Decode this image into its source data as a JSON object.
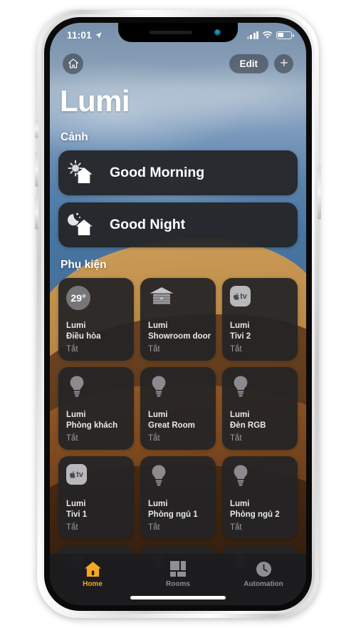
{
  "device": {
    "frame": "iphone-x-silver"
  },
  "status_bar": {
    "time": "11:01",
    "location_icon": "location-arrow-icon",
    "signal_icon": "cellular-signal-icon",
    "signal_bars": 4,
    "signal_filled": 3,
    "wifi_icon": "wifi-icon",
    "battery_icon": "battery-icon",
    "battery_level": 38
  },
  "nav": {
    "home_icon": "house-icon",
    "edit_label": "Edit",
    "add_label": "+",
    "add_icon": "plus-icon"
  },
  "header": {
    "title": "Lumi"
  },
  "scenes": {
    "section_title": "Cảnh",
    "items": [
      {
        "label": "Good Morning",
        "icon": "sun-house-icon"
      },
      {
        "label": "Good Night",
        "icon": "moon-house-icon"
      }
    ]
  },
  "accessories": {
    "section_title": "Phụ kiện",
    "items": [
      {
        "icon": "thermostat-icon",
        "temperature": "29°",
        "line1": "Lumi",
        "line2": "Điều hòa",
        "state": "Tắt"
      },
      {
        "icon": "garage-door-icon",
        "line1": "Lumi",
        "line2": "Showroom door",
        "state": "Tắt"
      },
      {
        "icon": "apple-tv-icon",
        "line1": "Lumi",
        "line2": "Tivi  2",
        "state": "Tắt"
      },
      {
        "icon": "lightbulb-icon",
        "line1": "Lumi",
        "line2": "Phòng khách",
        "state": "Tắt"
      },
      {
        "icon": "lightbulb-icon",
        "line1": "Lumi",
        "line2": "Great Room",
        "state": "Tắt"
      },
      {
        "icon": "lightbulb-icon",
        "line1": "Lumi",
        "line2": "Đèn  RGB",
        "state": "Tắt"
      },
      {
        "icon": "apple-tv-icon",
        "line1": "Lumi",
        "line2": "Tivi  1",
        "state": "Tắt"
      },
      {
        "icon": "lightbulb-icon",
        "line1": "Lumi",
        "line2": "Phòng ngủ 1",
        "state": "Tắt"
      },
      {
        "icon": "lightbulb-icon",
        "line1": "Lumi",
        "line2": "Phòng ngủ 2",
        "state": "Tắt"
      }
    ]
  },
  "tabbar": {
    "active": "Home",
    "items": [
      {
        "label": "Home",
        "icon": "house-filled-icon"
      },
      {
        "label": "Rooms",
        "icon": "rooms-grid-icon"
      },
      {
        "label": "Automation",
        "icon": "clock-icon"
      }
    ]
  },
  "colors": {
    "accent": "#f5a623",
    "tile_bg": "#242426",
    "tab_bg": "#1c1c1e",
    "text_primary": "#ffffff",
    "text_secondary": "#9b9b9f"
  }
}
